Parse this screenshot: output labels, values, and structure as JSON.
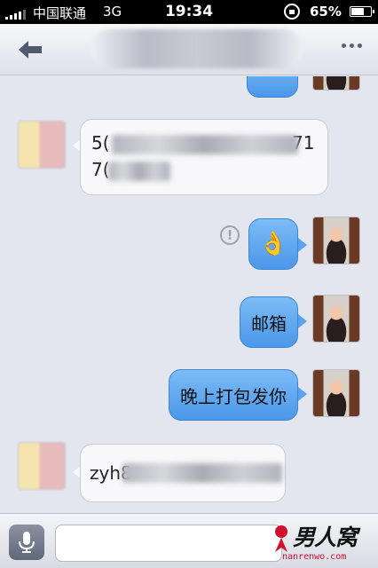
{
  "status_bar": {
    "carrier": "中国联通",
    "network": "3G",
    "time": "19:34",
    "battery": "65%"
  },
  "nav": {
    "back_icon": "back-arrow-icon",
    "more_icon": "more-dots-icon"
  },
  "messages": [
    {
      "direction": "in",
      "type": "text",
      "text_visible_start_line1": "5(",
      "text_visible_end_line1": "71",
      "text_visible_start_line2": "7("
    },
    {
      "direction": "out",
      "type": "emoji",
      "emoji": "👌",
      "status": "!"
    },
    {
      "direction": "out",
      "type": "text",
      "text": "邮箱"
    },
    {
      "direction": "out",
      "type": "text",
      "text": "晚上打包发你"
    },
    {
      "direction": "in",
      "type": "text",
      "text_visible_start": "zyh8"
    }
  ],
  "input": {
    "voice_icon": "microphone-icon"
  },
  "watermark": {
    "title": "男人窝",
    "url": "nanrenwo.com"
  }
}
